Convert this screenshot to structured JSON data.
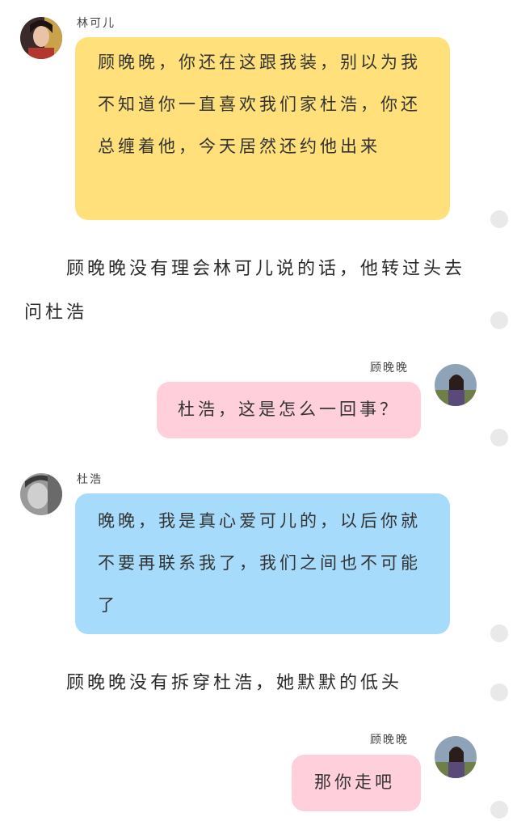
{
  "colors": {
    "yellow_bubble": "#ffe07a",
    "pink_bubble": "#ffcfdc",
    "blue_bubble": "#a7dbfb",
    "scroll_dot": "#e9e9e9"
  },
  "messages": [
    {
      "speaker": "林可儿",
      "side": "left",
      "avatar_icon": "girl-portrait-avatar",
      "text": "顾晚晚，你还在这跟我装，别以为我不知道你一直喜欢我们家杜浩，你还总缠着他，今天居然还约他出来"
    },
    {
      "type": "narration",
      "text": "顾晚晚没有理会林可儿说的话，他转过头去问杜浩"
    },
    {
      "speaker": "顾晚晚",
      "side": "right",
      "avatar_icon": "girl-outdoor-avatar",
      "text": "杜浩，这是怎么一回事？"
    },
    {
      "speaker": "杜浩",
      "side": "left",
      "avatar_icon": "boy-bw-avatar",
      "text": "晚晚，我是真心爱可儿的，以后你就不要再联系我了，我们之间也不可能了"
    },
    {
      "type": "narration",
      "text": "顾晚晚没有拆穿杜浩，她默默的低头"
    },
    {
      "speaker": "顾晚晚",
      "side": "right",
      "avatar_icon": "girl-outdoor-avatar",
      "text": "那你走吧"
    }
  ]
}
